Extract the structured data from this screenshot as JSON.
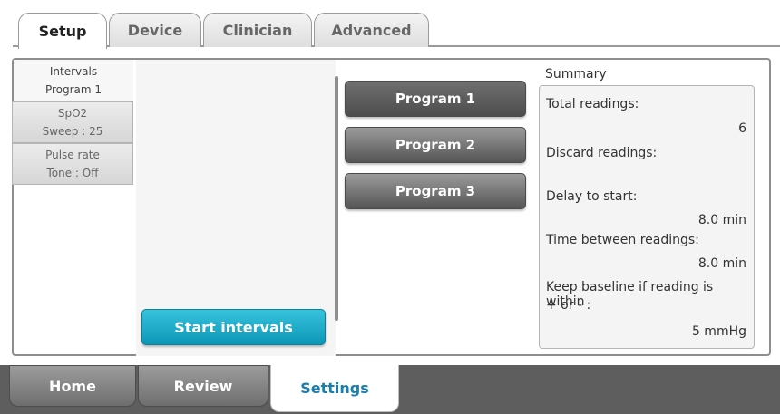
{
  "top_tabs": [
    {
      "label": "Setup",
      "active": true
    },
    {
      "label": "Device",
      "active": false
    },
    {
      "label": "Clinician",
      "active": false
    },
    {
      "label": "Advanced",
      "active": false
    }
  ],
  "left_list": [
    {
      "line1": "Intervals",
      "line2": "Program 1",
      "selected": true
    },
    {
      "line1": "SpO2",
      "line2": "Sweep : 25",
      "selected": false
    },
    {
      "line1": "Pulse rate",
      "line2": "Tone : Off",
      "selected": false
    }
  ],
  "start_button": "Start intervals",
  "programs": [
    {
      "label": "Program 1",
      "active": true
    },
    {
      "label": "Program 2",
      "active": false
    },
    {
      "label": "Program 3",
      "active": false
    }
  ],
  "summary": {
    "title": "Summary",
    "total_label": "Total readings:",
    "total_value": "6",
    "discard_label": "Discard readings:",
    "delay_label": "Delay to start:",
    "delay_value": "8.0 min",
    "between_label": "Time between readings:",
    "between_value": "8.0 min",
    "baseline_label_line1": "Keep baseline if reading is within",
    "baseline_label_line2": "+ or - :",
    "baseline_value": "5 mmHg"
  },
  "bottom_tabs": [
    {
      "label": "Home",
      "active": false
    },
    {
      "label": "Review",
      "active": false
    },
    {
      "label": "Settings",
      "active": true
    }
  ]
}
